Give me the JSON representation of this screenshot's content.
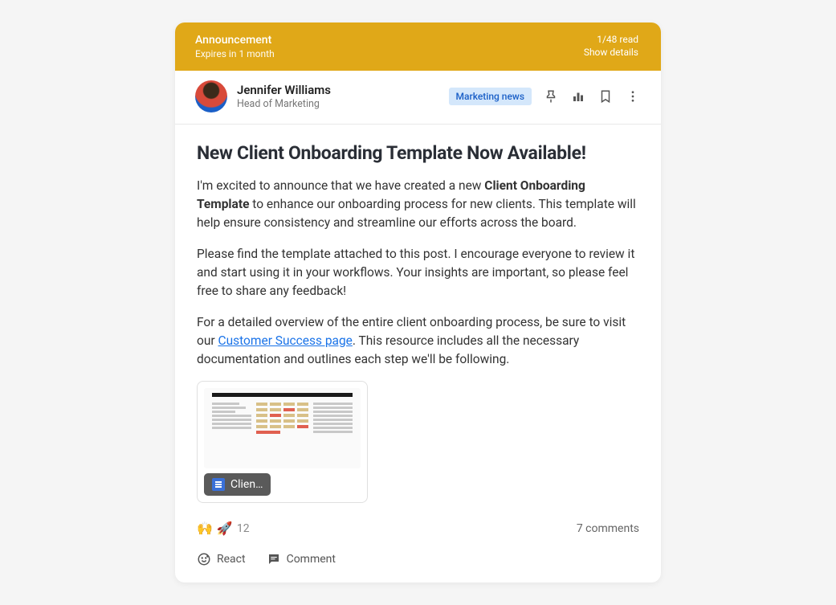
{
  "announcement": {
    "label": "Announcement",
    "expiry": "Expires in 1 month",
    "read_status": "1/48 read",
    "show_details": "Show details"
  },
  "author": {
    "name": "Jennifer Williams",
    "role": "Head of Marketing"
  },
  "badge": "Marketing news",
  "post": {
    "title": "New Client Onboarding Template Now Available!",
    "p1_a": "I'm excited to announce that we have created a new ",
    "p1_strong": "Client Onboarding Template",
    "p1_b": " to enhance our onboarding process for new clients. This template will help ensure consistency and streamline our efforts across the board.",
    "p2": "Please find the template attached to this post. I encourage everyone to review it and start using it in your workflows. Your insights are important, so please feel free to share any feedback!",
    "p3_a": "For a detailed overview of the entire client onboarding process, be sure to visit our ",
    "p3_link": "Customer Success page",
    "p3_b": ". This resource includes all the necessary documentation and outlines each step we'll be following."
  },
  "attachment": {
    "name": "Clien…"
  },
  "reactions": {
    "emoji1": "🙌",
    "emoji2": "🚀",
    "count": "12"
  },
  "comments_link": "7 comments",
  "actions": {
    "react": "React",
    "comment": "Comment"
  }
}
